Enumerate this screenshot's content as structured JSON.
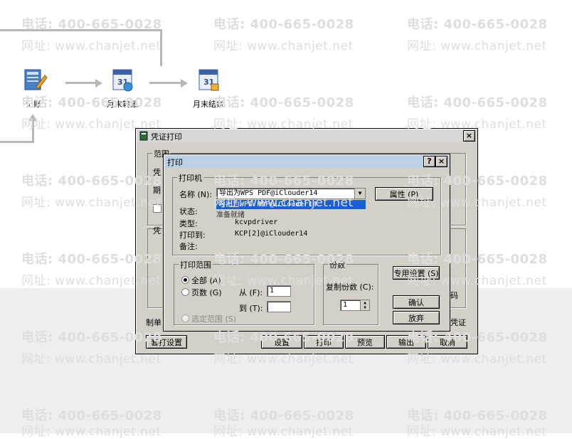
{
  "flow": {
    "node1": "记账",
    "node2": "月末转账",
    "node3": "月末结账"
  },
  "watermark": {
    "phone": "电话: 400-665-0028",
    "site": "网址: www.chanjet.net"
  },
  "outer_dialog": {
    "title": "凭证打印",
    "close": "×",
    "range_group": "范围",
    "fragment_voucher": "凭",
    "fragment_period": "期",
    "fragment_voucher2": "凭",
    "fragment_code": "码",
    "fragment_voucher3": "凭证",
    "fragment_maker": "制单",
    "btn_set_print": "套打设置",
    "btn_settings": "设置",
    "btn_print": "打印",
    "btn_preview": "预览",
    "btn_export": "输出",
    "btn_cancel": "取消"
  },
  "print_dialog": {
    "title": "打印",
    "help": "?",
    "close": "×",
    "printer_group": "打印机",
    "name_label": "名称 (N):",
    "name_value": "导出为WPS PDF@iClouder14",
    "dropdown_highlight": "导出为WPS PDF@iClouder14",
    "properties_btn": "属性 (P)",
    "status_label": "状态:",
    "status_value": "准备就绪",
    "type_label": "类型:",
    "type_value": "kcvpdriver",
    "printto_label": "打印到:",
    "printto_value": "KCP[2]@iClouder14",
    "comment_label": "备注:",
    "range_group": "打印范围",
    "all_label": "全部 (A)",
    "pages_label": "页数 (G)",
    "selection_label": "选定范围 (S)",
    "from_label": "从 (F):",
    "from_value": "1",
    "to_label": "到 (T):",
    "to_value": "",
    "copies_group": "份数",
    "copies_label": "复制份数 (C):",
    "copies_value": "1",
    "special_btn": "专用设置 (S)",
    "ok_btn": "确认",
    "cancel_btn": "放弃"
  }
}
